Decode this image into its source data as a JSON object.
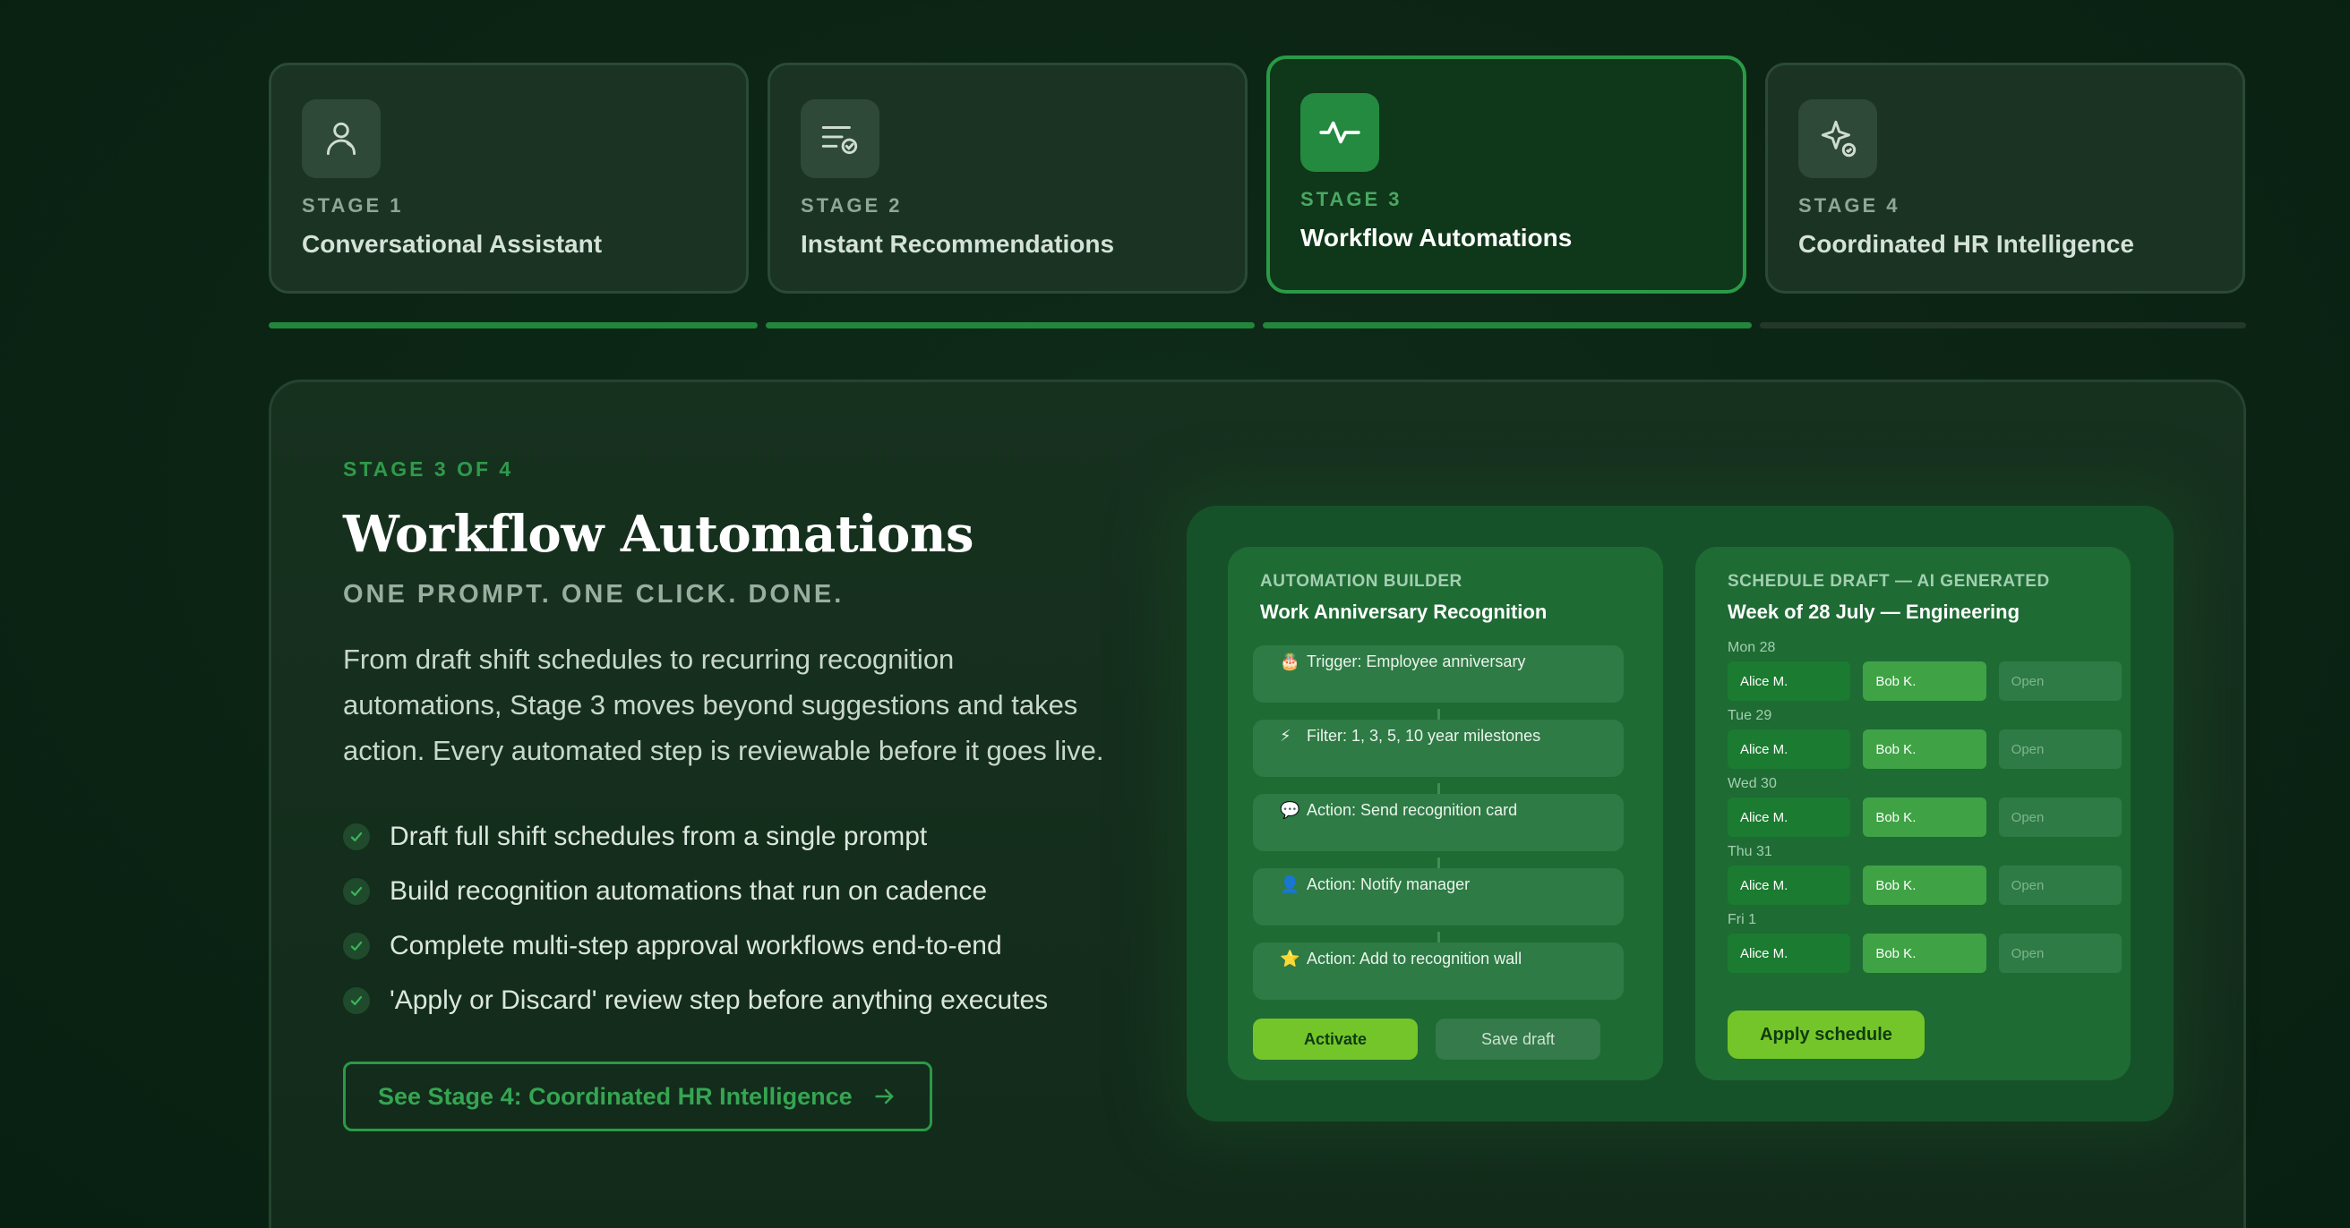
{
  "stages": [
    {
      "kicker": "STAGE 1",
      "name": "Conversational Assistant",
      "icon": "user-icon",
      "active": false
    },
    {
      "kicker": "STAGE 2",
      "name": "Instant Recommendations",
      "icon": "list-check-icon",
      "active": false
    },
    {
      "kicker": "STAGE 3",
      "name": "Workflow Automations",
      "icon": "activity-icon",
      "active": true
    },
    {
      "kicker": "STAGE 4",
      "name": "Coordinated HR Intelligence",
      "icon": "sparkle-check-icon",
      "active": false
    }
  ],
  "progress": {
    "completed_segments": 3,
    "total_segments": 4
  },
  "detail": {
    "kicker": "STAGE 3 OF 4",
    "title": "Workflow Automations",
    "subtitle": "ONE PROMPT. ONE CLICK. DONE.",
    "description": "From draft shift schedules to recurring recognition automations, Stage 3 moves beyond suggestions and takes action. Every automated step is reviewable before it goes live.",
    "bullets": [
      "Draft full shift schedules from a single prompt",
      "Build recognition automations that run on cadence",
      "Complete multi-step approval workflows end-to-end",
      "'Apply or Discard' review step before anything executes"
    ],
    "cta_label": "See Stage 4: Coordinated HR Intelligence"
  },
  "automation_builder": {
    "kicker": "AUTOMATION BUILDER",
    "title": "Work Anniversary Recognition",
    "steps": [
      {
        "icon": "🎂",
        "text": "Trigger: Employee anniversary"
      },
      {
        "icon": "⚡",
        "text": "Filter: 1, 3, 5, 10 year milestones"
      },
      {
        "icon": "💬",
        "text": "Action: Send recognition card"
      },
      {
        "icon": "👤",
        "text": "Action: Notify manager"
      },
      {
        "icon": "⭐",
        "text": "Action: Add to recognition wall"
      }
    ],
    "activate_label": "Activate",
    "save_label": "Save draft"
  },
  "schedule_draft": {
    "kicker": "SCHEDULE DRAFT — AI GENERATED",
    "title": "Week of 28 July — Engineering",
    "days": [
      {
        "label": "Mon 28",
        "slots": [
          "Alice M.",
          "Bob K.",
          "Open"
        ]
      },
      {
        "label": "Tue 29",
        "slots": [
          "Alice M.",
          "Bob K.",
          "Open"
        ]
      },
      {
        "label": "Wed 30",
        "slots": [
          "Alice M.",
          "Bob K.",
          "Open"
        ]
      },
      {
        "label": "Thu 31",
        "slots": [
          "Alice M.",
          "Bob K.",
          "Open"
        ]
      },
      {
        "label": "Fri 1",
        "slots": [
          "Alice M.",
          "Bob K.",
          "Open"
        ]
      }
    ],
    "apply_label": "Apply schedule"
  },
  "colors": {
    "accent": "#2a9a47",
    "lime": "#74c52a",
    "background": "#0b2414"
  }
}
